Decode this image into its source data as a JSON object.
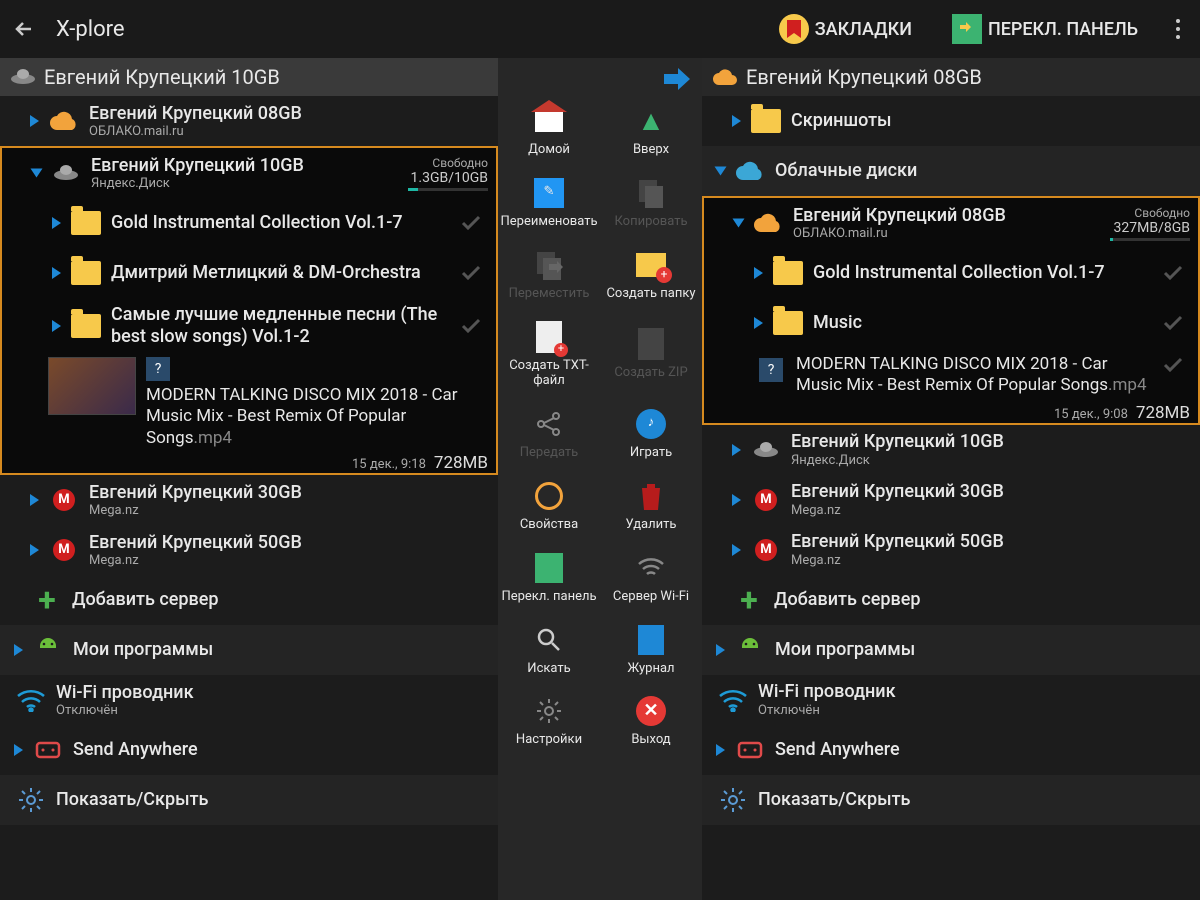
{
  "header": {
    "title": "X-plore",
    "bookmarks": "ЗАКЛАДКИ",
    "switch_panel": "ПЕРЕКЛ. ПАНЕЛЬ"
  },
  "left": {
    "path": "Евгений Крупецкий 10GB",
    "items": [
      {
        "title": "Евгений Крупецкий 08GB",
        "sub": "ОБЛАКО.mail.ru",
        "icon": "cloud"
      },
      {
        "title": "Евгений Крупецкий 10GB",
        "sub": "Яндекс.Диск",
        "icon": "ufo",
        "free_label": "Свободно",
        "storage": "1.3GB/10GB",
        "storage_pct": 13
      },
      {
        "title": "Gold Instrumental Collection Vol.1-7",
        "icon": "folder"
      },
      {
        "title": "Дмитрий Метлицкий & DM-Orchestra",
        "icon": "folder"
      },
      {
        "title": "Самые лучшие медленные песни (The best slow songs) Vol.1-2",
        "icon": "folder"
      },
      {
        "title": "MODERN TALKING DISCO MIX 2018 - Car Music Mix - Best Remix Of Popular Songs",
        "ext": ".mp4",
        "icon": "video",
        "date": "15 дек., 9:18",
        "size": "728MB"
      },
      {
        "title": "Евгений Крупецкий 30GB",
        "sub": "Mega.nz",
        "icon": "mega"
      },
      {
        "title": "Евгений Крупецкий 50GB",
        "sub": "Mega.nz",
        "icon": "mega"
      },
      {
        "title": "Добавить сервер",
        "icon": "plus"
      },
      {
        "title": "Мои программы",
        "icon": "android"
      },
      {
        "title": "Wi-Fi проводник",
        "sub": "Отключён",
        "icon": "wifi"
      },
      {
        "title": "Send Anywhere",
        "icon": "send"
      },
      {
        "title": "Показать/Скрыть",
        "icon": "gear"
      }
    ]
  },
  "right": {
    "path": "Евгений Крупецкий 08GB",
    "screenshots": "Скриншоты",
    "cloud_disks": "Облачные диски",
    "items": [
      {
        "title": "Евгений Крупецкий 08GB",
        "sub": "ОБЛАКО.mail.ru",
        "icon": "cloud",
        "free_label": "Свободно",
        "storage": "327MB/8GB",
        "storage_pct": 4
      },
      {
        "title": "Gold Instrumental Collection Vol.1-7",
        "icon": "folder"
      },
      {
        "title": "Music",
        "icon": "folder"
      },
      {
        "title": "MODERN TALKING DISCO MIX 2018 - Car Music Mix - Best Remix Of Popular Songs",
        "ext": ".mp4",
        "icon": "video",
        "date": "15 дек., 9:08",
        "size": "728MB"
      },
      {
        "title": "Евгений Крупецкий 10GB",
        "sub": "Яндекс.Диск",
        "icon": "ufo"
      },
      {
        "title": "Евгений Крупецкий 30GB",
        "sub": "Mega.nz",
        "icon": "mega"
      },
      {
        "title": "Евгений Крупецкий 50GB",
        "sub": "Mega.nz",
        "icon": "mega"
      },
      {
        "title": "Добавить сервер",
        "icon": "plus"
      },
      {
        "title": "Мои программы",
        "icon": "android"
      },
      {
        "title": "Wi-Fi проводник",
        "sub": "Отключён",
        "icon": "wifi"
      },
      {
        "title": "Send Anywhere",
        "icon": "send"
      },
      {
        "title": "Показать/Скрыть",
        "icon": "gear"
      }
    ]
  },
  "toolbar": {
    "home": "Домой",
    "up": "Вверх",
    "rename": "Переименовать",
    "copy": "Копировать",
    "move": "Переместить",
    "create_folder": "Создать папку",
    "create_txt": "Создать TXT-файл",
    "create_zip": "Создать ZIP",
    "share": "Передать",
    "play": "Играть",
    "properties": "Свойства",
    "delete": "Удалить",
    "switch_panel": "Перекл. панель",
    "wifi_server": "Сервер Wi-Fi",
    "search": "Искать",
    "log": "Журнал",
    "settings": "Настройки",
    "exit": "Выход"
  }
}
